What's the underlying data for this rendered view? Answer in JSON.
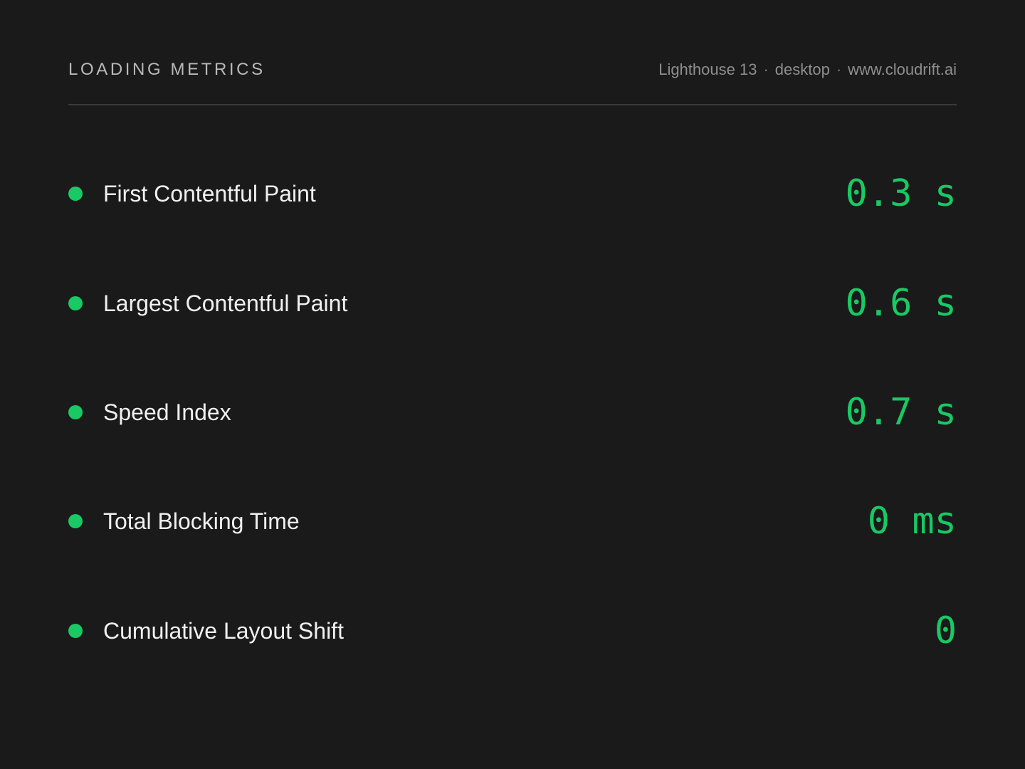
{
  "header": {
    "title": "LOADING METRICS",
    "meta": {
      "tool": "Lighthouse 13",
      "device": "desktop",
      "site": "www.cloudrift.ai",
      "separator": "·"
    }
  },
  "colors": {
    "background": "#1a1a1a",
    "good": "#18c964",
    "label": "#f0f0f0",
    "muted": "#8e8e8e"
  },
  "metrics": [
    {
      "label": "First Contentful Paint",
      "value": "0.3 s",
      "status": "good"
    },
    {
      "label": "Largest Contentful Paint",
      "value": "0.6 s",
      "status": "good"
    },
    {
      "label": "Speed Index",
      "value": "0.7 s",
      "status": "good"
    },
    {
      "label": "Total Blocking Time",
      "value": "0 ms",
      "status": "good"
    },
    {
      "label": "Cumulative Layout Shift",
      "value": "0",
      "status": "good"
    }
  ]
}
